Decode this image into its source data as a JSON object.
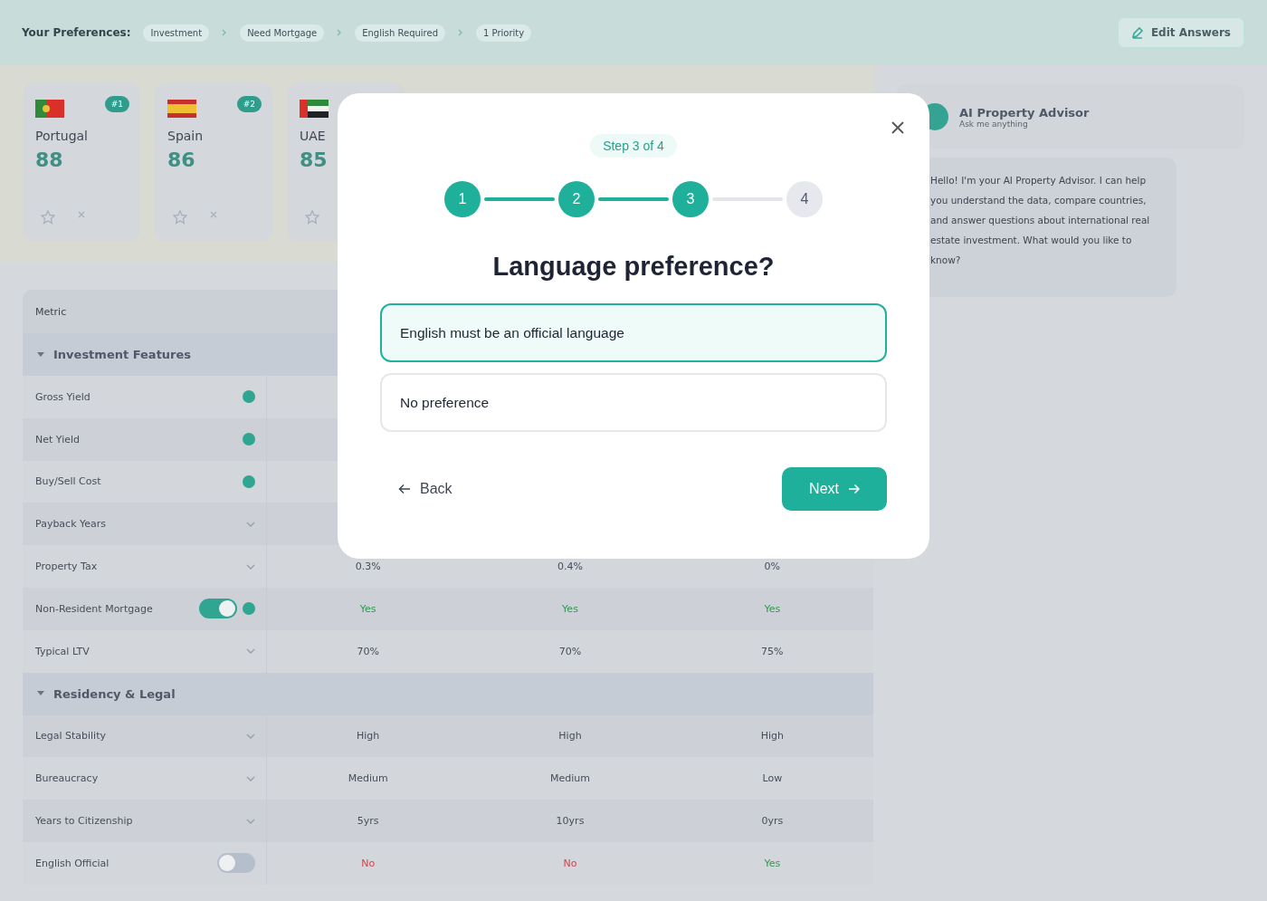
{
  "header": {
    "label": "Your Preferences:",
    "chips": [
      "Investment",
      "Need Mortgage",
      "English Required",
      "1 Priority"
    ],
    "edit_button": "Edit Answers"
  },
  "cards": [
    {
      "kind": "portugal",
      "country": "Portugal",
      "rank": "#1",
      "score": "88"
    },
    {
      "kind": "spain",
      "country": "Spain",
      "rank": "#2",
      "score": "86"
    },
    {
      "kind": "uae",
      "country": "UAE",
      "score": "85"
    }
  ],
  "table": {
    "column_header": "Metric",
    "sections": [
      {
        "title": "Investment Features",
        "expanded": true,
        "rows": [
          {
            "label": "Gross Yield",
            "kind": "dot"
          },
          {
            "label": "Net Yield",
            "kind": "dot"
          },
          {
            "label": "Buy/Sell Cost",
            "kind": "dot"
          },
          {
            "label": "Payback Years",
            "kind": "chevron"
          },
          {
            "label": "Property Tax",
            "kind": "chevron",
            "values": [
              {
                "text": "0.3%"
              },
              {
                "text": "0.4%"
              },
              {
                "text": "0%"
              }
            ]
          },
          {
            "label": "Non-Resident Mortgage",
            "kind": "toggle",
            "on": true,
            "values": [
              {
                "text": "Yes",
                "color": "#2f9a52"
              },
              {
                "text": "Yes",
                "color": "#2f9a52"
              },
              {
                "text": "Yes",
                "color": "#2f9a52"
              }
            ]
          },
          {
            "label": "Typical LTV",
            "kind": "chevron",
            "values": [
              {
                "text": "70%"
              },
              {
                "text": "70%"
              },
              {
                "text": "75%"
              }
            ]
          }
        ]
      },
      {
        "title": "Residency & Legal",
        "expanded": true,
        "rows": [
          {
            "label": "Legal Stability",
            "kind": "chevron",
            "values": [
              {
                "text": "High"
              },
              {
                "text": "High"
              },
              {
                "text": "High"
              }
            ]
          },
          {
            "label": "Bureaucracy",
            "kind": "chevron",
            "values": [
              {
                "text": "Medium"
              },
              {
                "text": "Medium"
              },
              {
                "text": "Low"
              }
            ]
          },
          {
            "label": "Years to Citizenship",
            "kind": "chevron",
            "values": [
              {
                "text": "5yrs"
              },
              {
                "text": "10yrs"
              },
              {
                "text": "0yrs"
              }
            ]
          },
          {
            "label": "English Official",
            "kind": "toggle",
            "on": false,
            "values": [
              {
                "text": "No",
                "color": "#d04550"
              },
              {
                "text": "No",
                "color": "#d04550"
              },
              {
                "text": "Yes",
                "color": "#2f9a52"
              }
            ]
          }
        ]
      }
    ]
  },
  "advisor": {
    "title": "AI Property Advisor",
    "subtitle": "Ask me anything",
    "message": "Hello! I'm your AI Property Advisor. I can help you understand the data, compare countries, and answer questions about international real estate investment. What would you like to know?"
  },
  "modal": {
    "step_label": "Step 3 of 4",
    "steps": [
      {
        "label": "1",
        "done": true
      },
      {
        "label": "2",
        "done": true
      },
      {
        "label": "3",
        "done": true
      },
      {
        "label": "4",
        "done": false
      }
    ],
    "title": "Language preference?",
    "options": [
      {
        "label": "English must be an official language",
        "selected": true
      },
      {
        "label": "No preference",
        "selected": false
      }
    ],
    "back": "Back",
    "next": "Next"
  }
}
